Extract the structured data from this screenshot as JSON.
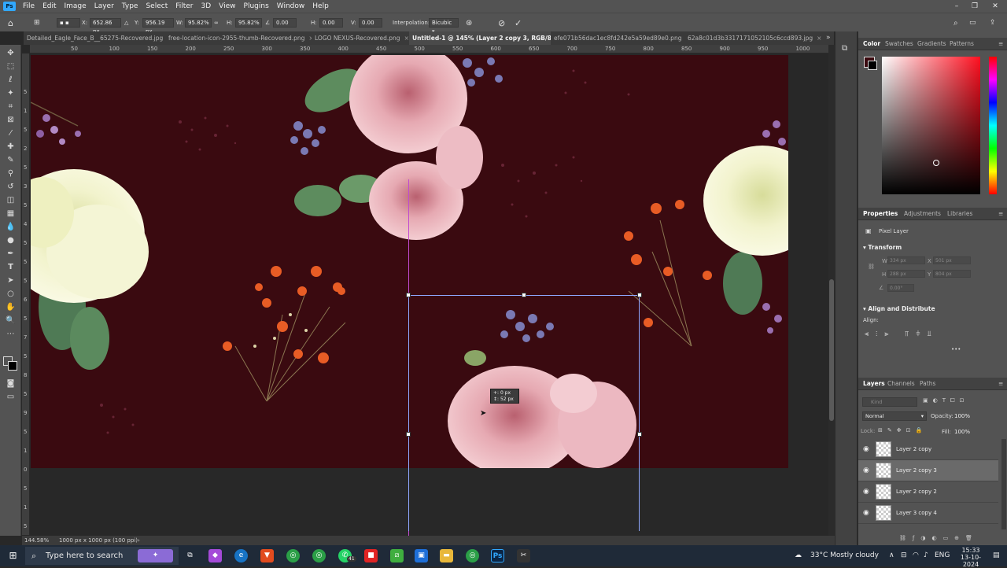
{
  "menubar": {
    "logo": "Ps",
    "items": [
      "File",
      "Edit",
      "Image",
      "Layer",
      "Type",
      "Select",
      "Filter",
      "3D",
      "View",
      "Plugins",
      "Window",
      "Help"
    ],
    "window_controls": [
      "–",
      "❐",
      "✕"
    ]
  },
  "options": {
    "x_label": "X:",
    "x_value": "652.86 px",
    "y_label": "Y:",
    "y_value": "956.19 px",
    "w_label": "W:",
    "w_value": "95.82%",
    "h_label": "H:",
    "h_value": "95.82%",
    "angle_value": "0.00",
    "hskew_label": "H:",
    "hskew_value": "0.00",
    "vskew_label": "V:",
    "vskew_value": "0.00",
    "interp_label": "Interpolation:",
    "interp_value": "Bicubic"
  },
  "tabs": [
    {
      "label": "Detailed_Eagle_Face_B__65275-Recovered.jpg"
    },
    {
      "label": "free-location-icon-2955-thumb-Recovered.png"
    },
    {
      "label": "LOGO NEXUS-Recovered.png"
    },
    {
      "label": "Untitled-1 @ 145% (Layer 2 copy 3, RGB/8#) *"
    },
    {
      "label": "efe071b56dac1ec8fd242e5a59ed89e0.png"
    },
    {
      "label": "62a8c01d3b3317171052105c6ccd893.jpg"
    }
  ],
  "ruler_top": [
    "50",
    "100",
    "150",
    "200",
    "250",
    "300",
    "350",
    "400",
    "450",
    "500",
    "550",
    "600",
    "650",
    "700",
    "750",
    "800",
    "850",
    "900",
    "950",
    "1000"
  ],
  "ruler_left": [
    "5",
    "1",
    "5",
    "2",
    "5",
    "3",
    "5",
    "4",
    "5",
    "5",
    "5",
    "6",
    "5",
    "7",
    "5",
    "8",
    "5",
    "9",
    "5",
    "1",
    "0",
    "5",
    "1",
    "5"
  ],
  "canvas": {
    "tooltip_x": "+: 0 px",
    "tooltip_y": "↕: 52 px"
  },
  "status": {
    "zoom": "144.58%",
    "doc": "1000 px x 1000 px (100 ppi)"
  },
  "color_panel": {
    "tabs": [
      "Color",
      "Swatches",
      "Gradients",
      "Patterns"
    ],
    "fg_color": "#3a0a10"
  },
  "properties": {
    "tabs": [
      "Properties",
      "Adjustments",
      "Libraries"
    ],
    "layer_type": "Pixel Layer",
    "transform_title": "Transform",
    "w_label": "W",
    "w_value": "334 px",
    "x_label": "X",
    "x_value": "501 px",
    "h_label": "H",
    "h_value": "288 px",
    "y_label": "Y",
    "y_value": "804 px",
    "angle_value": "0.00°",
    "align_title": "Align and Distribute",
    "align_label": "Align:",
    "more": "•••"
  },
  "layers": {
    "tabs": [
      "Layers",
      "Channels",
      "Paths"
    ],
    "kind_placeholder": "Kind",
    "blend": "Normal",
    "opacity_label": "Opacity:",
    "opacity_value": "100%",
    "lock_label": "Lock:",
    "fill_label": "Fill:",
    "fill_value": "100%",
    "rows": [
      {
        "name": "Layer 2 copy"
      },
      {
        "name": "Layer 2 copy 3"
      },
      {
        "name": "Layer 2 copy 2"
      },
      {
        "name": "Layer 3 copy 4"
      }
    ]
  },
  "taskbar": {
    "search_placeholder": "Type here to search",
    "weather": "33°C  Mostly cloudy",
    "lang": "ENG",
    "time": "15:33",
    "date": "13-10-2024",
    "whatsapp_badge": "41"
  }
}
